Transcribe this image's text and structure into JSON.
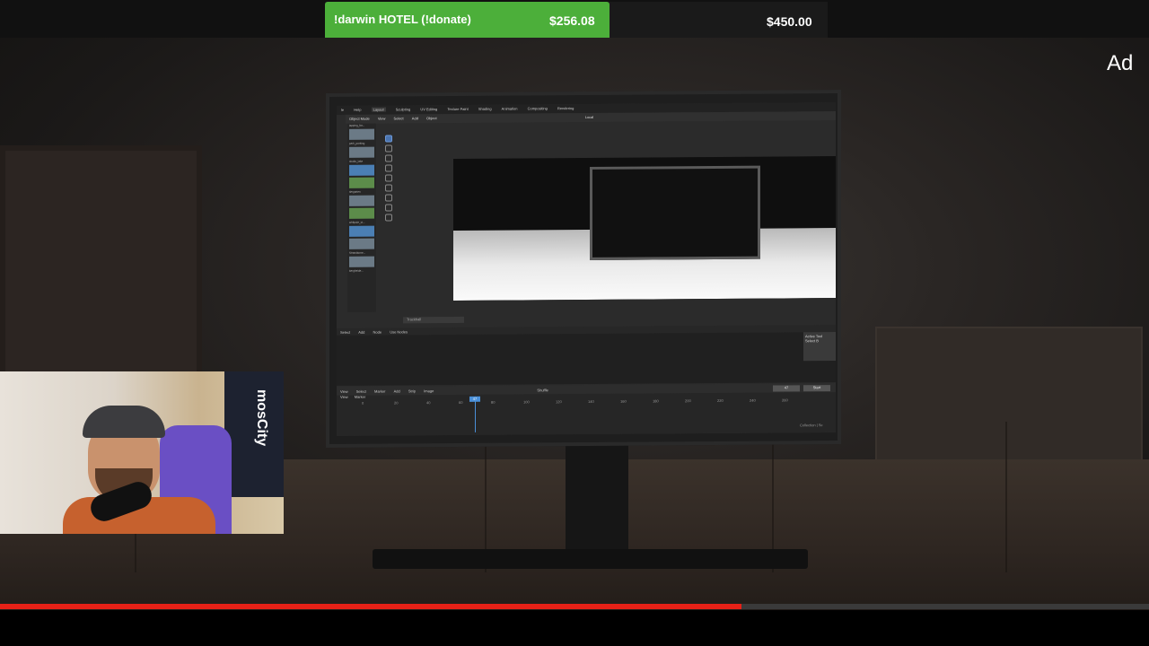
{
  "donation": {
    "label": "!darwin HOTEL (!donate)",
    "current": "$256.08",
    "target": "$450.00",
    "progress_fraction": 0.569,
    "fill_color": "#4caf3a"
  },
  "ad": {
    "label": "Ad"
  },
  "video": {
    "progress_fraction": 0.645,
    "progress_color": "#e62117"
  },
  "blender": {
    "menu": [
      "le",
      "Help",
      "Layout",
      "Sculpting",
      "UV Editing",
      "Texture Paint",
      "Shading",
      "Animation",
      "Compositing",
      "Rendering"
    ],
    "toolbar": [
      "Object Mode",
      "View",
      "Select",
      "Add",
      "Object",
      "Local"
    ],
    "assets": [
      "lapping_far...",
      "park_parking",
      "studio_lake",
      "",
      "tiergarten",
      "",
      "whitpole_st...",
      "",
      "Strandtorne...",
      "",
      "bergheide..."
    ],
    "tracking_label": "Trackball",
    "node_menu": [
      "Select",
      "Add",
      "Node",
      "Use Nodes"
    ],
    "active_tool_title": "Active Tool",
    "active_tool_sub": "Select B",
    "timeline_menu": [
      "View",
      "Select",
      "Marker",
      "Add",
      "Strip",
      "Image"
    ],
    "timeline_sub": [
      "View",
      "Marker"
    ],
    "shuffle_label": "Shuffle",
    "frame_current": "47",
    "start_label": "Start",
    "ruler": [
      "0",
      "20",
      "40",
      "60",
      "80",
      "100",
      "120",
      "140",
      "160",
      "180",
      "200",
      "220",
      "240",
      "260"
    ],
    "playhead_label": "47",
    "collection_label": "Collection | Sc"
  },
  "webcam": {
    "banner_text": "mosCity"
  }
}
